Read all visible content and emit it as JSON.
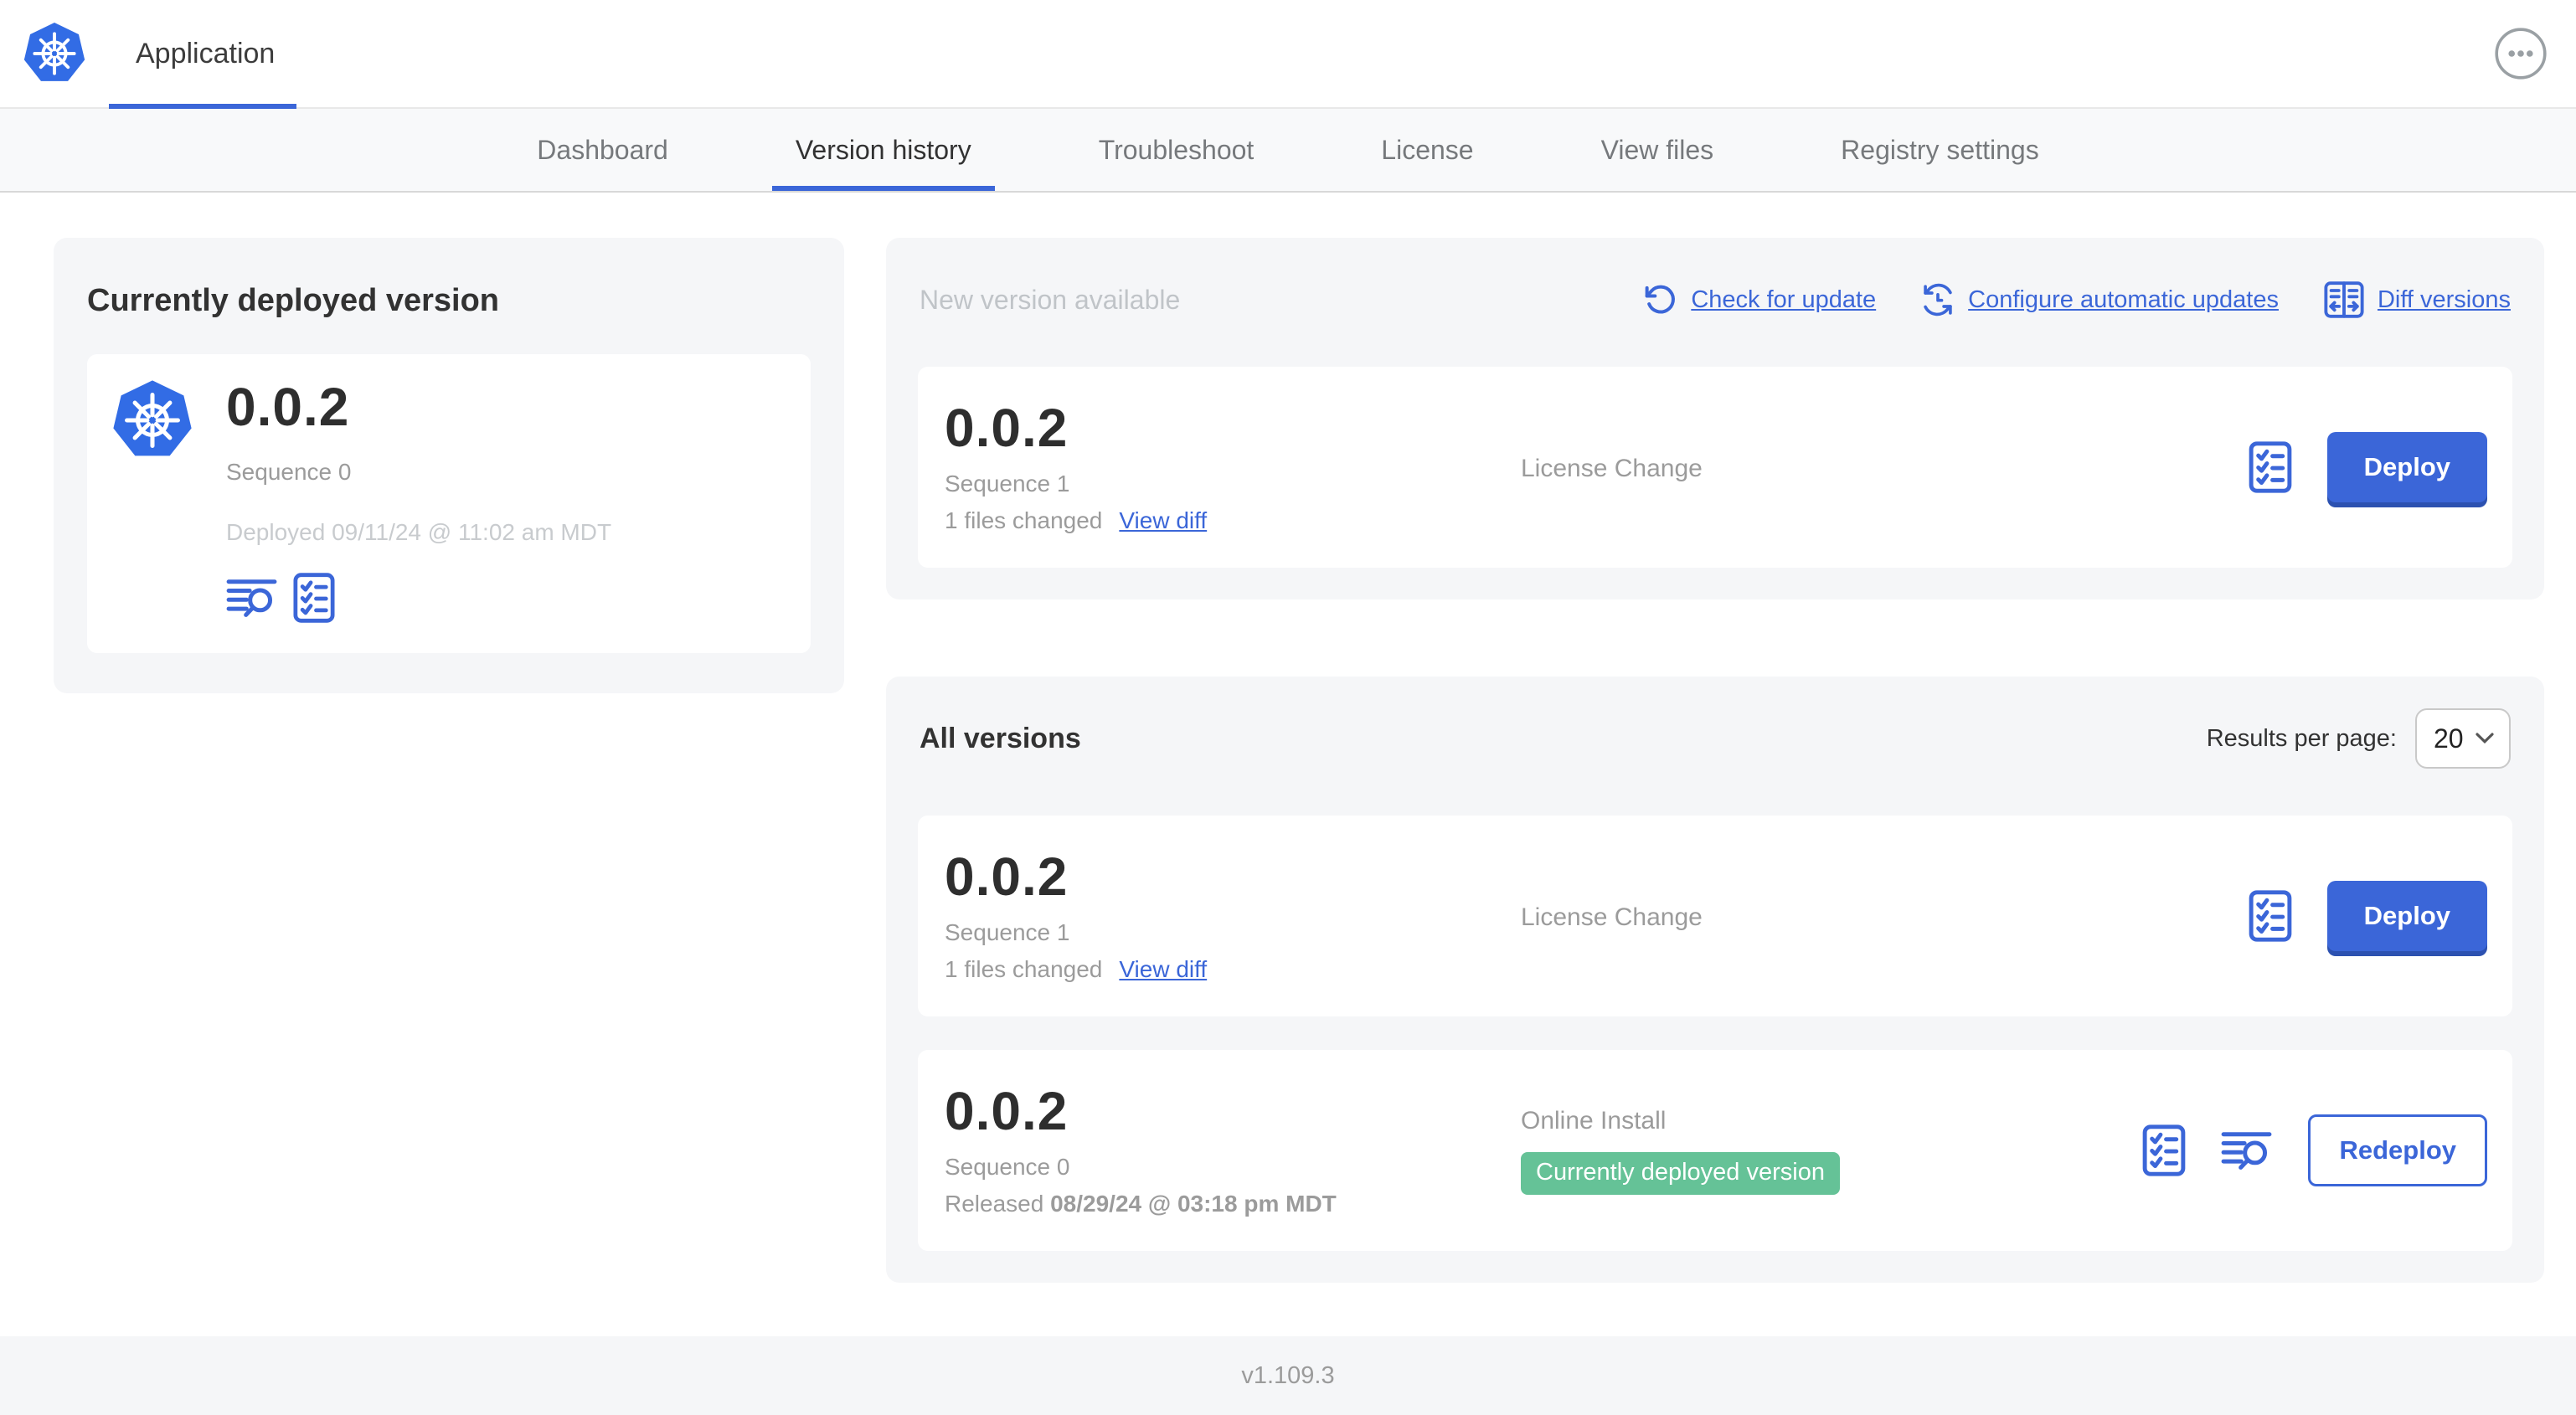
{
  "colors": {
    "accent_blue": "#3B66D8",
    "kubernetes_blue": "#326CE5",
    "badge_green": "#65C297",
    "card_background": "#F5F6F8"
  },
  "header": {
    "app_title": "Application"
  },
  "nav": {
    "active_tab": "Version history",
    "tabs": [
      {
        "label": "Dashboard"
      },
      {
        "label": "Version history"
      },
      {
        "label": "Troubleshoot"
      },
      {
        "label": "License"
      },
      {
        "label": "View files"
      },
      {
        "label": "Registry settings"
      }
    ]
  },
  "current_version_card": {
    "title": "Currently deployed version",
    "version": "0.0.2",
    "sequence": "Sequence 0",
    "deployed": "Deployed 09/11/24 @ 11:02 am MDT"
  },
  "new_version_section": {
    "title": "New version available",
    "actions": {
      "check_for_update": "Check for update",
      "configure_automatic_updates": "Configure automatic updates",
      "diff_versions": "Diff versions"
    },
    "row": {
      "version": "0.0.2",
      "sequence": "Sequence 1",
      "files_changed": "1 files changed",
      "view_diff": "View diff",
      "source": "License Change",
      "action": "Deploy"
    }
  },
  "all_versions_section": {
    "title": "All versions",
    "results_per_page_label": "Results per page:",
    "results_per_page_value": "20",
    "rows": [
      {
        "version": "0.0.2",
        "sequence": "Sequence 1",
        "files_changed": "1 files changed",
        "view_diff": "View diff",
        "source": "License Change",
        "action": "Deploy"
      },
      {
        "version": "0.0.2",
        "sequence": "Sequence 0",
        "released_prefix": "Released",
        "released_date": "08/29/24 @ 03:18 pm MDT",
        "source": "Online Install",
        "badge": "Currently deployed version",
        "action": "Redeploy"
      }
    ]
  },
  "footer": {
    "app_version": "v1.109.3"
  }
}
